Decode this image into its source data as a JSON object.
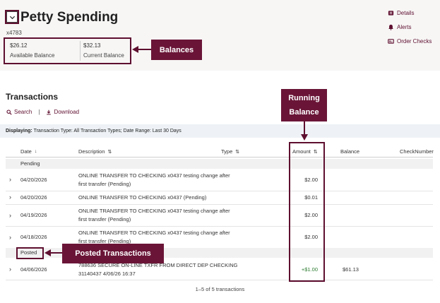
{
  "account": {
    "title": "Petty Spending",
    "number": "x4783",
    "available_balance": "$26.12",
    "available_label": "Available Balance",
    "current_balance": "$32.13",
    "current_label": "Current Balance"
  },
  "side_links": [
    {
      "label": "Details",
      "icon": "details-icon"
    },
    {
      "label": "Alerts",
      "icon": "bell-icon"
    },
    {
      "label": "Order Checks",
      "icon": "checkbook-icon"
    }
  ],
  "annotations": {
    "balances": "Balances",
    "running_line1": "Running",
    "running_line2": "Balance",
    "posted": "Posted Transactions"
  },
  "transactions": {
    "title": "Transactions",
    "search_label": "Search",
    "download_label": "Download",
    "filter_prefix": "Displaying:",
    "filter_text": "Transaction Type: All Transaction Types; Date Range: Last 30 Days",
    "columns": [
      "Date",
      "Description",
      "Type",
      "Amount",
      "Balance",
      "CheckNumber"
    ],
    "pending_label": "Pending",
    "posted_label": "Posted",
    "pending": [
      {
        "date": "04/20/2026",
        "desc1": "ONLINE TRANSFER TO CHECKING x0437 testing change after",
        "desc2": "first transfer (Pending)",
        "amount": "$2.00"
      },
      {
        "date": "04/20/2026",
        "desc1": "ONLINE TRANSFER TO CHECKING x0437 (Pending)",
        "desc2": "",
        "amount": "$0.01"
      },
      {
        "date": "04/19/2026",
        "desc1": "ONLINE TRANSFER TO CHECKING x0437 testing change after",
        "desc2": "first transfer (Pending)",
        "amount": "$2.00"
      },
      {
        "date": "04/18/2026",
        "desc1": "ONLINE TRANSFER TO CHECKING x0437 testing change after",
        "desc2": "first transfer (Pending)",
        "amount": "$2.00"
      }
    ],
    "posted": [
      {
        "date": "04/06/2026",
        "desc1": "788636 SECURE ON-LINE TXFR FROM DIRECT DEP CHECKING",
        "desc2": "31140437 4/06/26 16:37",
        "amount": "+$1.00",
        "balance": "$61.13"
      }
    ],
    "count_text": "1–5 of 5 transactions"
  },
  "colors": {
    "brand": "#6e1e3a",
    "callout_bg": "#6a1537",
    "credit": "#2e7d32"
  }
}
